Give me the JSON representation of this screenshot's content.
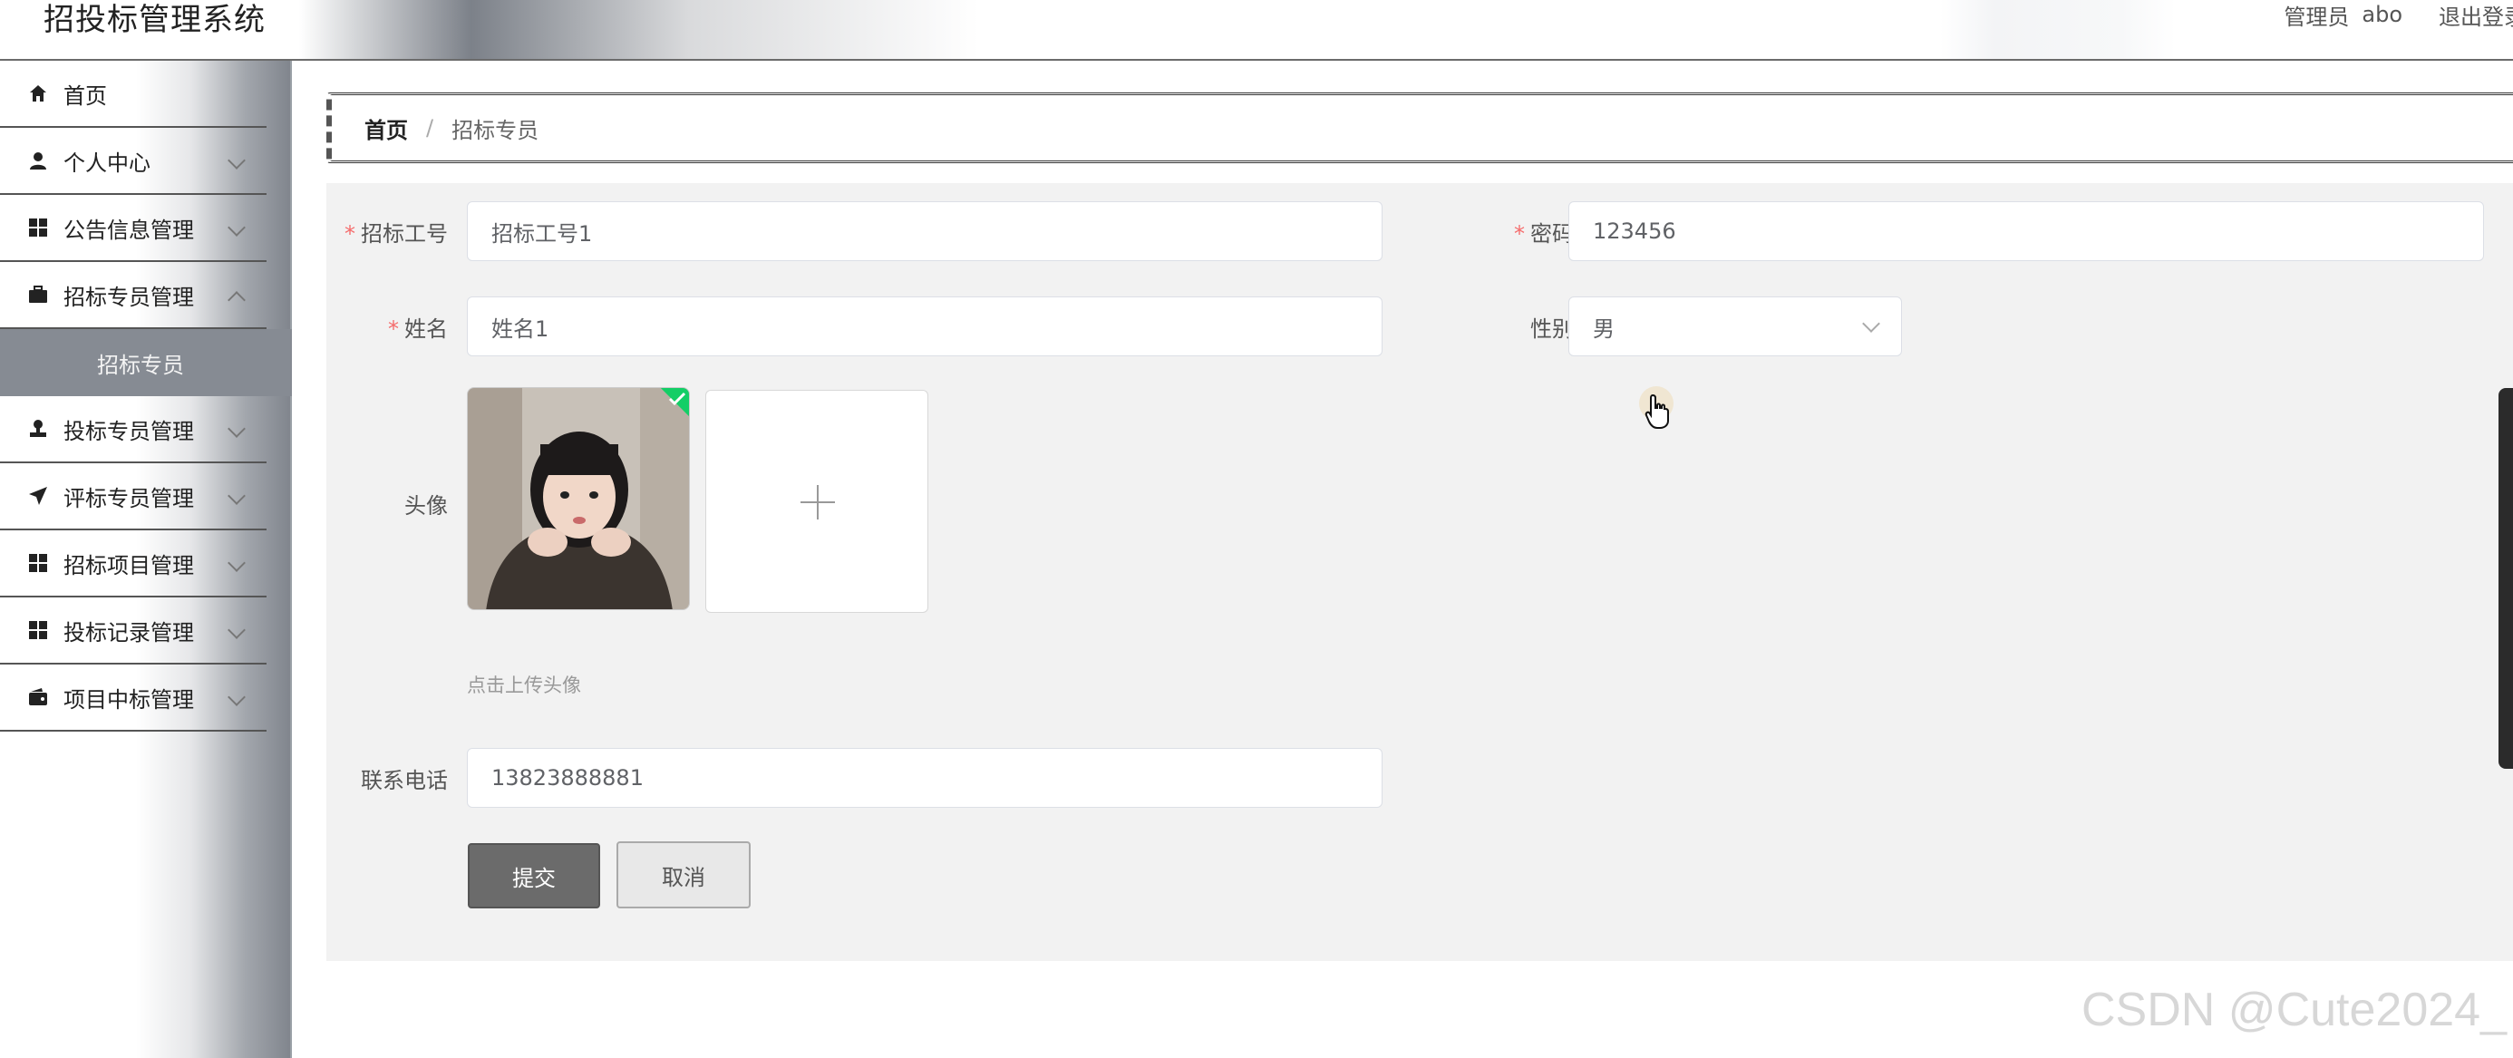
{
  "header": {
    "app_title": "招投标管理系统",
    "role": "管理员",
    "username": "abo",
    "logout": "退出登录"
  },
  "sidebar": {
    "items": [
      {
        "label": "首页",
        "icon": "home-icon"
      },
      {
        "label": "个人中心",
        "icon": "user-icon"
      },
      {
        "label": "公告信息管理",
        "icon": "grid-icon"
      },
      {
        "label": "招标专员管理",
        "icon": "briefcase-icon"
      },
      {
        "label": "投标专员管理",
        "icon": "stamp-icon"
      },
      {
        "label": "评标专员管理",
        "icon": "paper-plane-icon"
      },
      {
        "label": "招标项目管理",
        "icon": "grid-icon"
      },
      {
        "label": "投标记录管理",
        "icon": "grid-icon"
      },
      {
        "label": "项目中标管理",
        "icon": "wallet-icon"
      }
    ],
    "active_subitem": "招标专员"
  },
  "breadcrumb": {
    "home": "首页",
    "separator": "/",
    "current": "招标专员"
  },
  "form": {
    "tender_id": {
      "label": "招标工号",
      "value": "招标工号1",
      "required": true
    },
    "password": {
      "label": "密码",
      "value": "123456",
      "required": true
    },
    "name": {
      "label": "姓名",
      "value": "姓名1",
      "required": true
    },
    "gender": {
      "label": "性别",
      "value": "男"
    },
    "avatar": {
      "label": "头像",
      "hint": "点击上传头像"
    },
    "phone": {
      "label": "联系电话",
      "value": "13823888881"
    },
    "submit_label": "提交",
    "cancel_label": "取消"
  },
  "watermark": "CSDN @Cute2024_",
  "colors": {
    "required": "#f56c6c",
    "active_menu": "#868b93",
    "submit_button": "#6b6b6b",
    "success_badge": "#13ce66"
  }
}
